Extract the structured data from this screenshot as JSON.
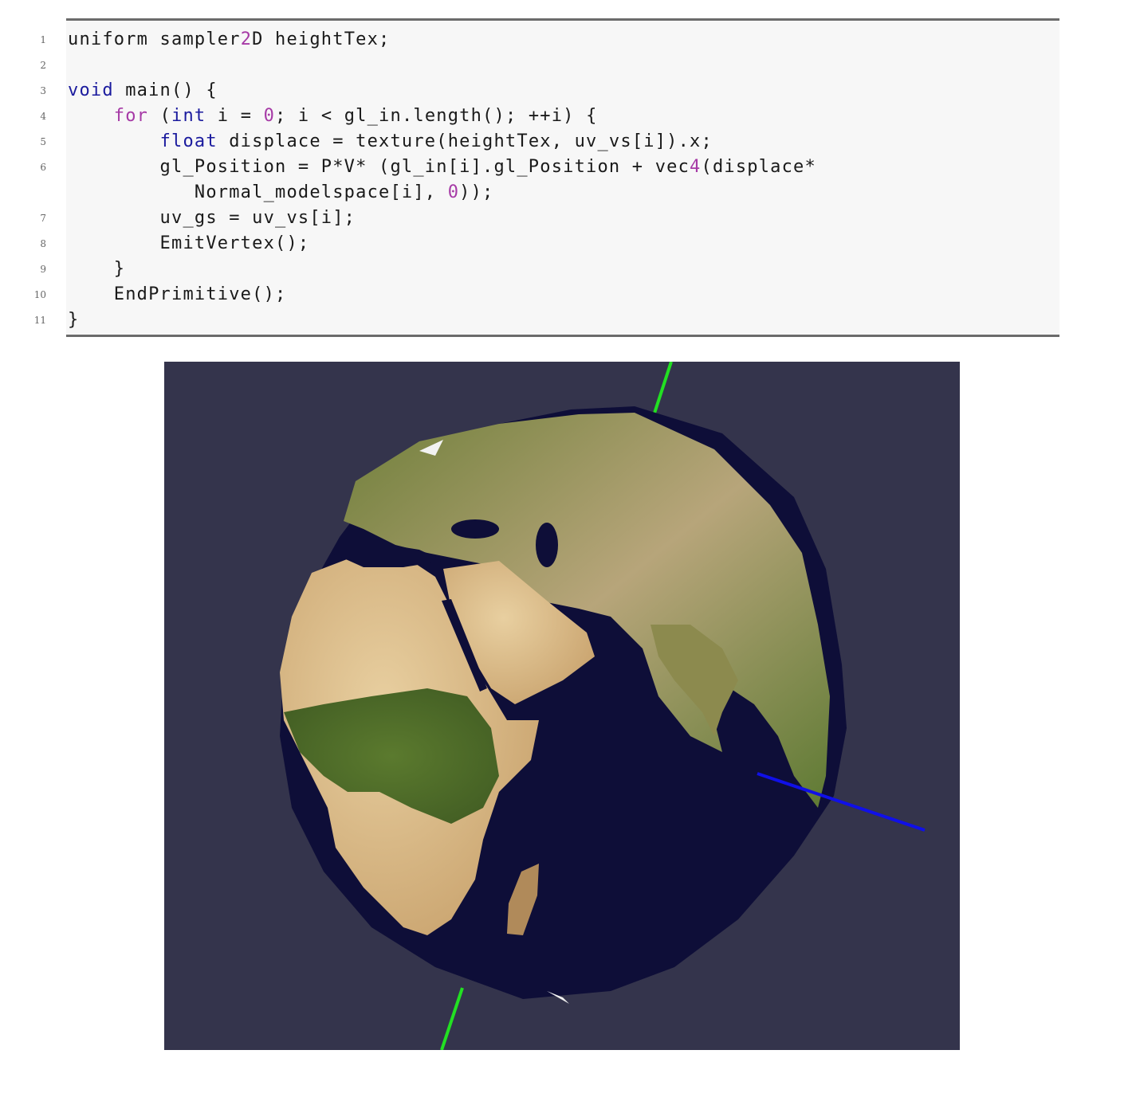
{
  "listing": {
    "lines": [
      {
        "num": "1",
        "tokens": [
          {
            "t": "uniform sampler",
            "c": "plain"
          },
          {
            "t": "2",
            "c": "num"
          },
          {
            "t": "D heightTex;",
            "c": "plain"
          }
        ]
      },
      {
        "num": "2",
        "tokens": []
      },
      {
        "num": "3",
        "tokens": [
          {
            "t": "void",
            "c": "kw"
          },
          {
            "t": " main() {",
            "c": "plain"
          }
        ]
      },
      {
        "num": "4",
        "tokens": [
          {
            "t": "    ",
            "c": "plain"
          },
          {
            "t": "for",
            "c": "kw2"
          },
          {
            "t": " (",
            "c": "plain"
          },
          {
            "t": "int",
            "c": "kw"
          },
          {
            "t": " i = ",
            "c": "plain"
          },
          {
            "t": "0",
            "c": "num"
          },
          {
            "t": "; i < gl_in.length(); ++i) {",
            "c": "plain"
          }
        ]
      },
      {
        "num": "5",
        "tokens": [
          {
            "t": "        ",
            "c": "plain"
          },
          {
            "t": "float",
            "c": "kw"
          },
          {
            "t": " displace = texture(heightTex, uv_vs[i]).x;",
            "c": "plain"
          }
        ]
      },
      {
        "num": "6",
        "tokens": [
          {
            "t": "        gl_Position = P*V* (gl_in[i].gl_Position + vec",
            "c": "plain"
          },
          {
            "t": "4",
            "c": "num"
          },
          {
            "t": "(displace*",
            "c": "plain"
          }
        ]
      },
      {
        "num": "",
        "tokens": [
          {
            "t": "           Normal_modelspace[i], ",
            "c": "plain"
          },
          {
            "t": "0",
            "c": "num"
          },
          {
            "t": "));",
            "c": "plain"
          }
        ]
      },
      {
        "num": "7",
        "tokens": [
          {
            "t": "        uv_gs = uv_vs[i];",
            "c": "plain"
          }
        ]
      },
      {
        "num": "8",
        "tokens": [
          {
            "t": "        EmitVertex();",
            "c": "plain"
          }
        ]
      },
      {
        "num": "9",
        "tokens": [
          {
            "t": "    }",
            "c": "plain"
          }
        ]
      },
      {
        "num": "10",
        "tokens": [
          {
            "t": "    EndPrimitive();",
            "c": "plain"
          }
        ]
      },
      {
        "num": "11",
        "tokens": [
          {
            "t": "}",
            "c": "plain"
          }
        ]
      }
    ]
  },
  "colors": {
    "keyword_blue": "#1b1b9e",
    "keyword_magenta": "#a63aa6",
    "number_magenta": "#a63aa6",
    "render_background": "#34344c",
    "ocean": "#0e0e38",
    "axis_green": "#22e022",
    "axis_blue": "#1010e8"
  },
  "figure": {
    "subject": "earth-sphere-render",
    "axes": [
      "green-axis",
      "blue-axis"
    ]
  }
}
